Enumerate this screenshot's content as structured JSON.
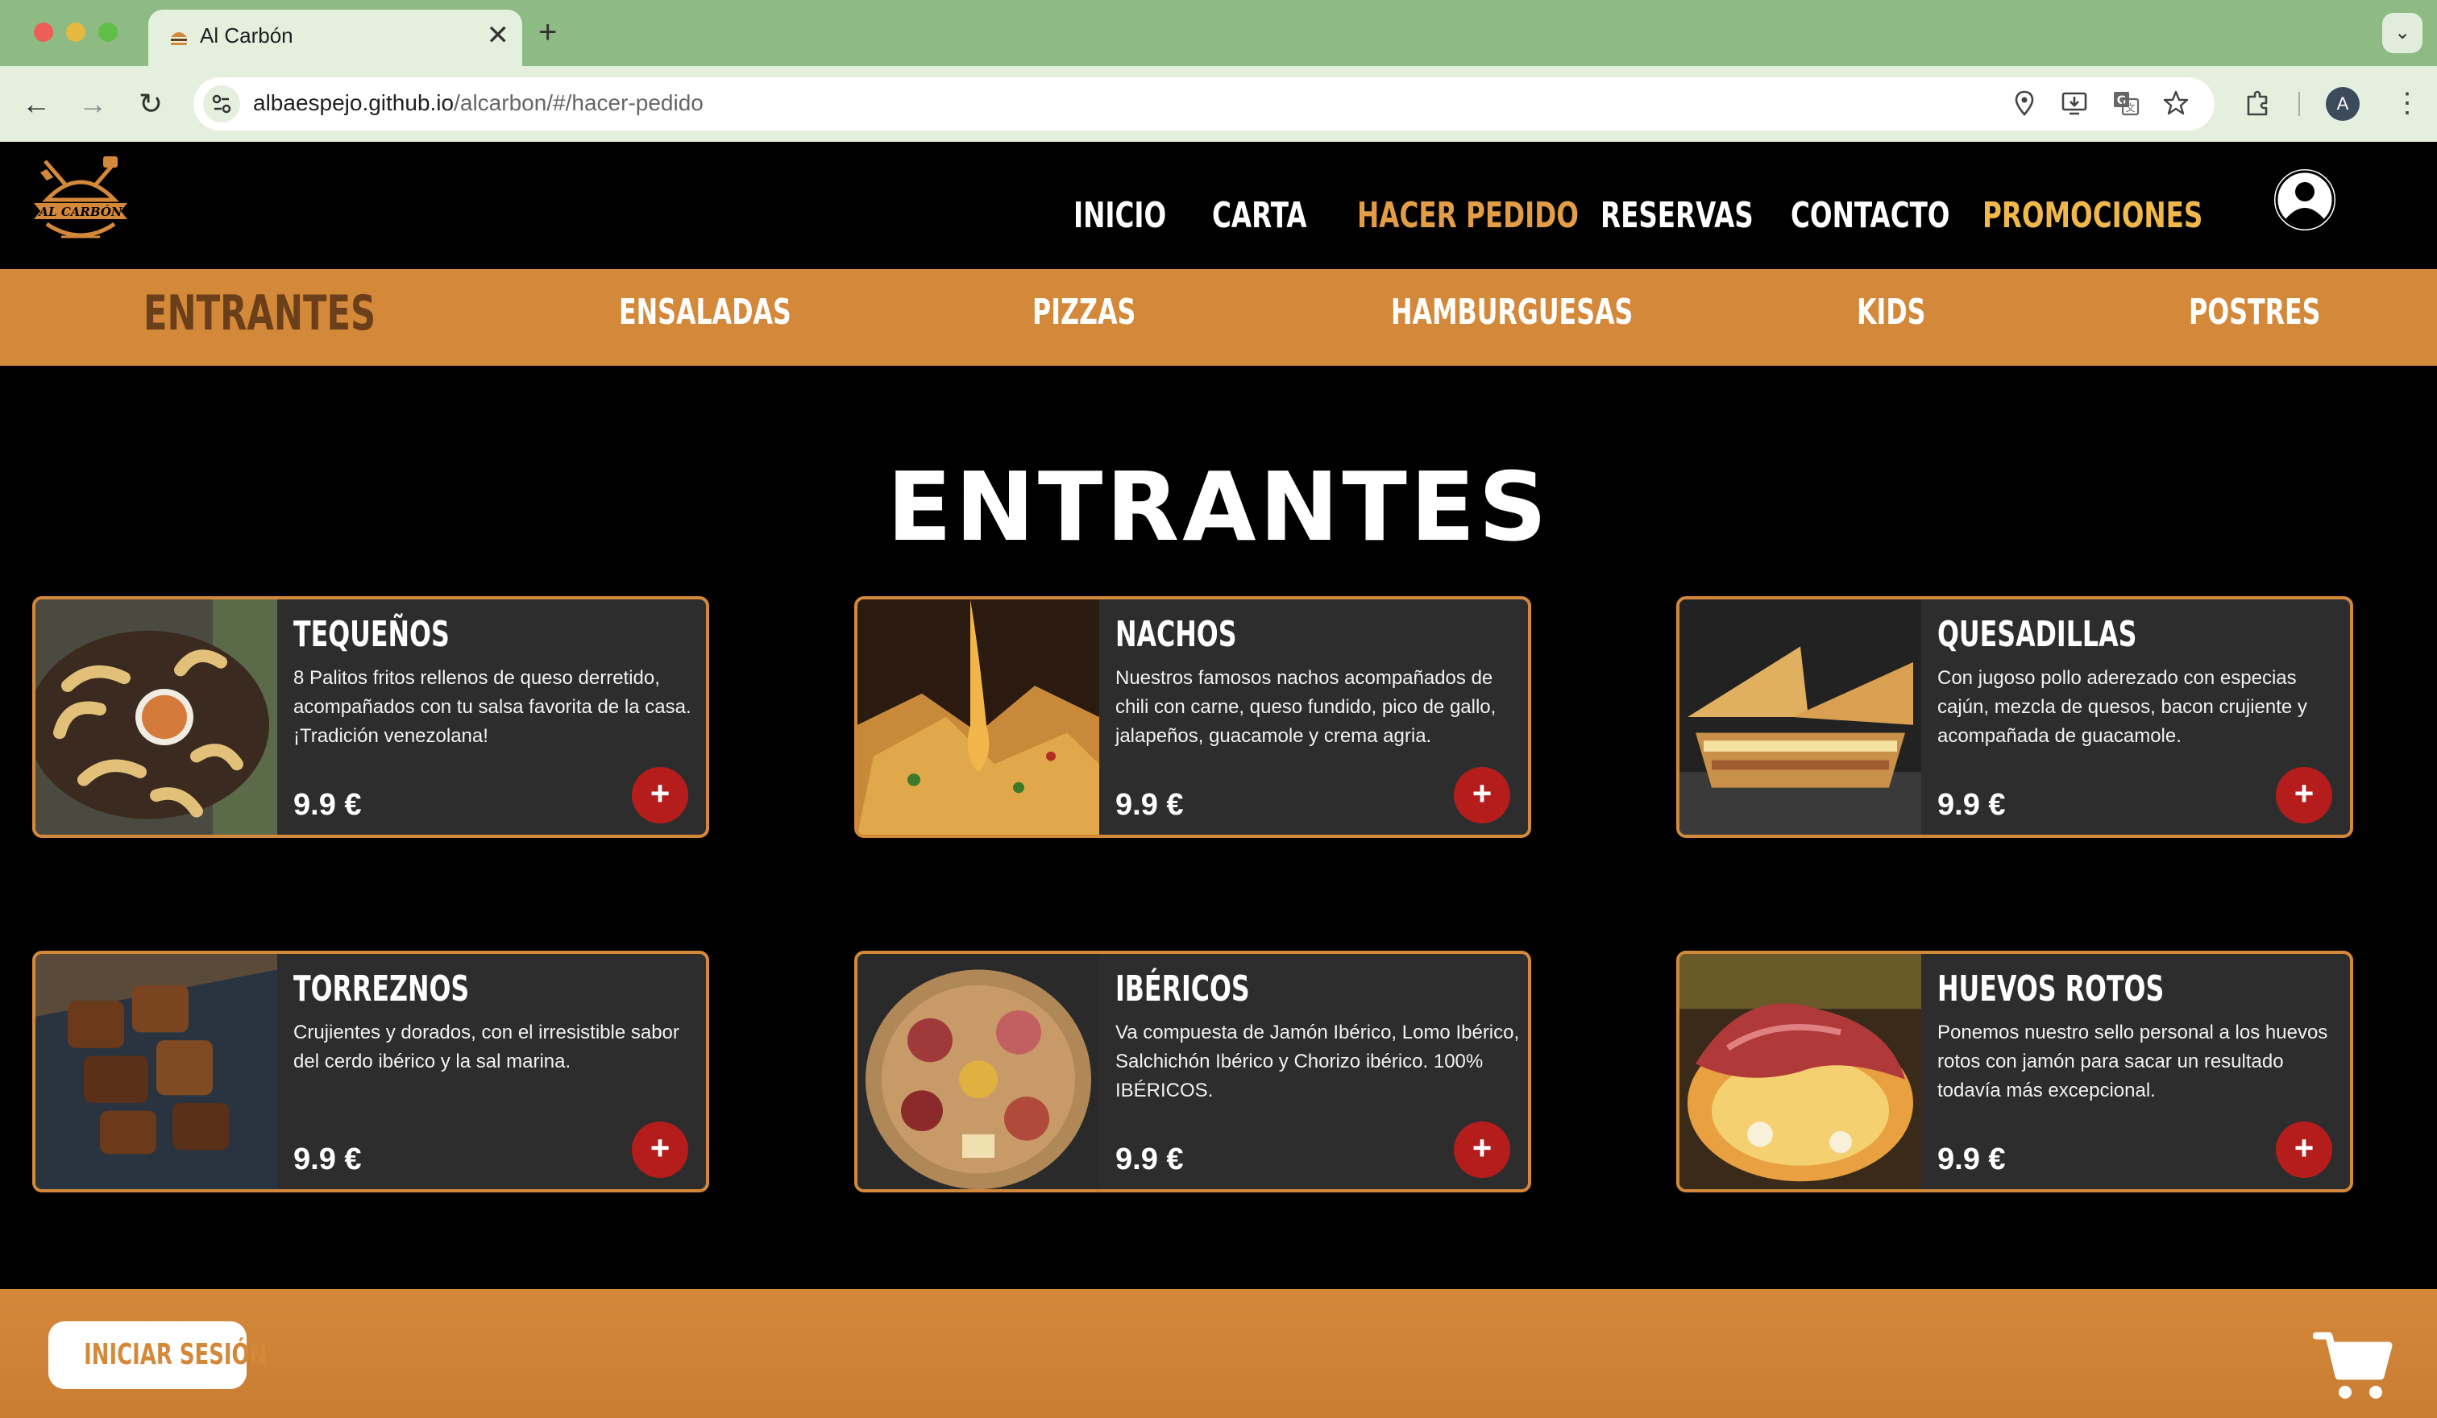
{
  "browser": {
    "tab_title": "Al Carbón",
    "new_tab_label": "+",
    "close_tab_label": "✕",
    "url_host": "albaespejo.github.io",
    "url_path": "/alcarbon/#/hacer-pedido",
    "profile_initial": "A"
  },
  "header": {
    "logo_text": "AL CARBÓN",
    "nav": {
      "inicio": "INICIO",
      "carta": "CARTA",
      "hacer_pedido": "HACER PEDIDO",
      "reservas": "RESERVAS",
      "contacto": "CONTACTO",
      "promociones": "PROMOCIONES"
    },
    "accent_color": "#e49d47"
  },
  "categories": {
    "entrantes": "ENTRANTES",
    "ensaladas": "ENSALADAS",
    "pizzas": "PIZZAS",
    "hamburguesas": "HAMBURGUESAS",
    "kids": "KIDS",
    "postres": "POSTRES",
    "active": "ENTRANTES"
  },
  "section": {
    "title": "ENTRANTES"
  },
  "products": [
    {
      "name": "TEQUEÑOS",
      "description": "8 Palitos fritos rellenos de queso derretido, acompañados con tu salsa favorita de la casa. ¡Tradición venezolana!",
      "price": "9.9 €",
      "add_label": "+"
    },
    {
      "name": "NACHOS",
      "description": "Nuestros famosos nachos acompañados de chili con carne, queso fundido, pico de gallo, jalapeños, guacamole y crema agria.",
      "price": "9.9 €",
      "add_label": "+"
    },
    {
      "name": "QUESADILLAS",
      "description": "Con jugoso pollo aderezado con especias cajún, mezcla de quesos, bacon crujiente y acompañada de guacamole.",
      "price": "9.9 €",
      "add_label": "+"
    },
    {
      "name": "TORREZNOS",
      "description": "Crujientes y dorados, con el irresistible sabor del cerdo ibérico y la sal marina.",
      "price": "9.9 €",
      "add_label": "+"
    },
    {
      "name": "IBÉRICOS",
      "description": "Va compuesta de Jamón Ibérico, Lomo Ibérico, Salchichón Ibérico y Chorizo ibérico. 100% IBÉRICOS.",
      "price": "9.9 €",
      "add_label": "+"
    },
    {
      "name": "HUEVOS ROTOS",
      "description": "Ponemos nuestro sello personal a los huevos rotos con jamón para sacar un resultado todavía más excepcional.",
      "price": "9.9 €",
      "add_label": "+"
    }
  ],
  "footer": {
    "login_label": "INICIAR SESIÓN"
  },
  "icons": {
    "back": "arrow-left-icon",
    "forward": "arrow-right-icon",
    "reload": "reload-icon",
    "site_info": "tune-icon",
    "location": "location-pin-icon",
    "install": "install-app-icon",
    "translate": "translate-icon",
    "bookmark": "star-icon",
    "extensions": "puzzle-icon",
    "menu": "kebab-menu-icon",
    "user": "user-circle-icon",
    "cart": "shopping-cart-icon"
  }
}
